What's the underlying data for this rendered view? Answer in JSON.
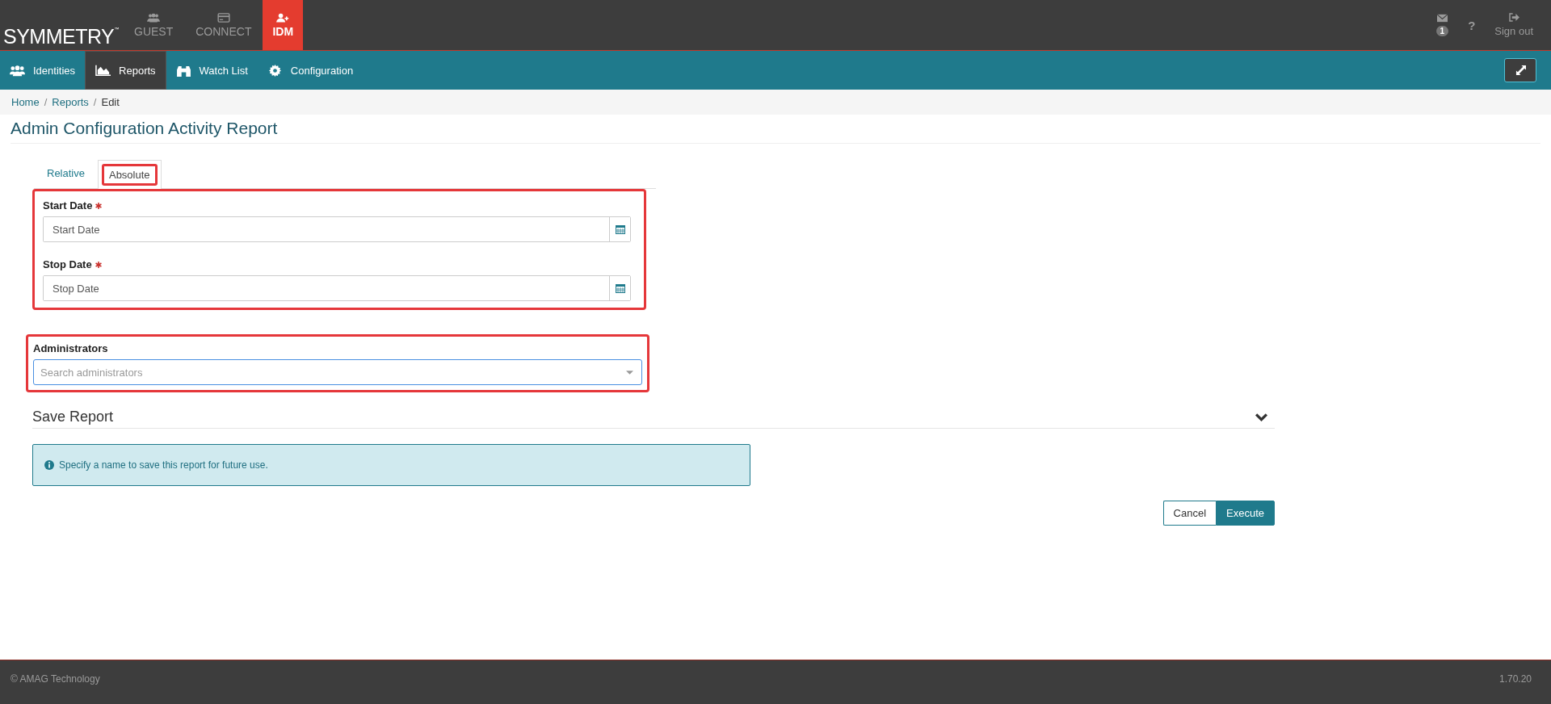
{
  "brand": {
    "name": "SYMMETRY",
    "mark": "™"
  },
  "modules": [
    {
      "label": "GUEST",
      "selected": false
    },
    {
      "label": "CONNECT",
      "selected": false
    },
    {
      "label": "IDM",
      "selected": true
    }
  ],
  "header_actions": {
    "messages_count": "1",
    "help": "?",
    "sign_out": "Sign out"
  },
  "nav": [
    {
      "label": "Identities",
      "selected": false
    },
    {
      "label": "Reports",
      "selected": true
    },
    {
      "label": "Watch List",
      "selected": false
    },
    {
      "label": "Configuration",
      "selected": false
    }
  ],
  "breadcrumbs": [
    {
      "label": "Home",
      "current": false,
      "separator": "/"
    },
    {
      "label": "Reports",
      "current": false,
      "separator": "/"
    },
    {
      "label": "Edit",
      "current": true
    }
  ],
  "title": "Admin Configuration Activity Report",
  "tabs": [
    {
      "label": "Relative",
      "selected": false,
      "highlighted": false
    },
    {
      "label": "Absolute",
      "selected": true,
      "highlighted": true
    }
  ],
  "date_group": {
    "highlighted": true,
    "fields": [
      {
        "label": "Start Date",
        "required": true,
        "placeholder": "Start Date"
      },
      {
        "label": "Stop Date",
        "required": true,
        "placeholder": "Stop Date"
      }
    ]
  },
  "administrators": {
    "highlighted": true,
    "label": "Administrators",
    "placeholder": "Search administrators"
  },
  "save_report": {
    "title": "Save Report",
    "info": "Specify a name to save this report for future use."
  },
  "buttons": [
    {
      "label": "Cancel",
      "kind": "secondary"
    },
    {
      "label": "Execute",
      "kind": "primary"
    }
  ],
  "footer": {
    "copyright": "© AMAG Technology",
    "version": "1.70.20"
  }
}
